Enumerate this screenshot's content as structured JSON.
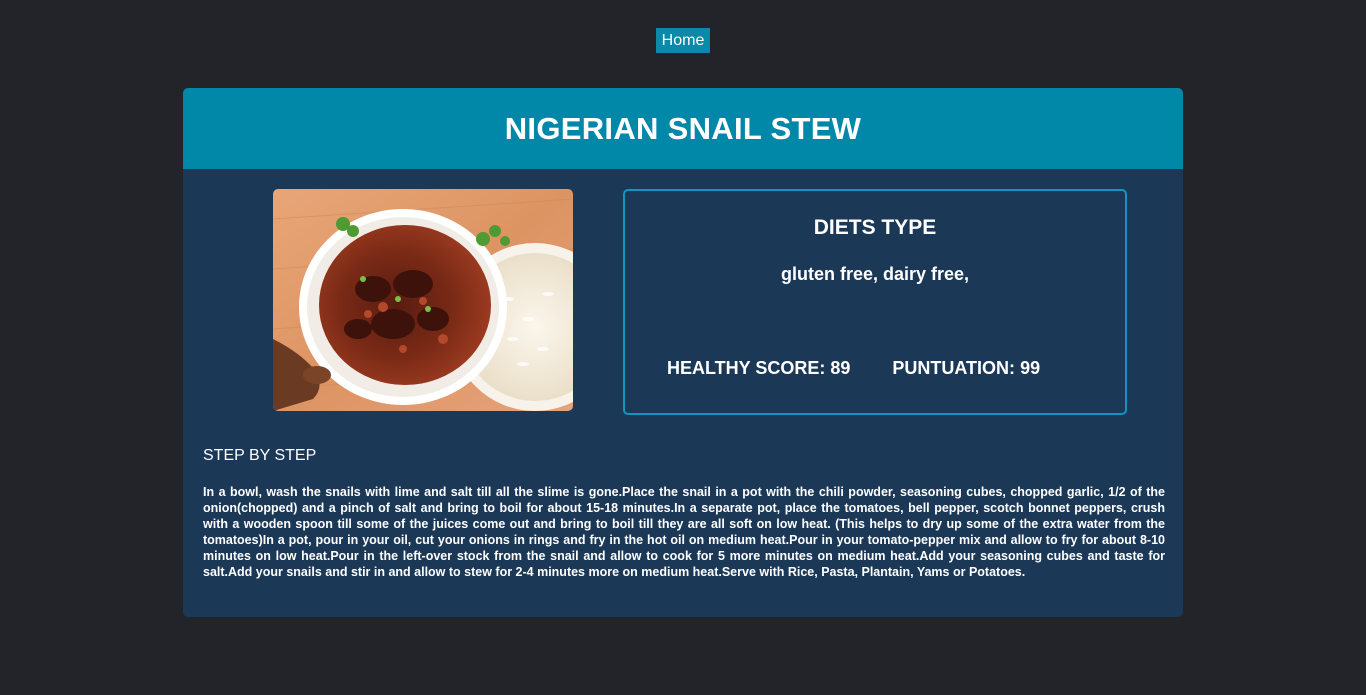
{
  "nav": {
    "home_label": "Home"
  },
  "recipe": {
    "title": "NIGERIAN SNAIL STEW",
    "image_alt": "Nigerian snail stew with rice",
    "diets_heading": "DIETS TYPE",
    "diets": "gluten free, dairy free,",
    "healthy_score_label": "HEALTHY SCORE:",
    "healthy_score": "89",
    "puntuation_label": "PUNTUATION:",
    "puntuation": "99",
    "steps_heading": "STEP BY STEP",
    "steps_text": "In a bowl, wash the snails with lime and salt till all the slime is gone.Place the snail in a pot with the chili powder, seasoning cubes, chopped garlic, 1/2 of the onion(chopped) and a pinch of salt and bring to boil for about 15-18 minutes.In a separate pot, place the tomatoes, bell pepper, scotch bonnet peppers, crush with a wooden spoon till some of the juices come out and bring to boil till they are all soft on low heat. (This helps to dry up some of the extra water from the tomatoes)In a pot, pour in your oil, cut your onions in rings and fry in the hot oil on medium heat.Pour in your tomato-pepper mix and allow to fry for about 8-10 minutes on low heat.Pour in the left-over stock from the snail and allow to cook for 5 more minutes on medium heat.Add your seasoning cubes and taste for salt.Add your snails and stir in and allow to stew for 2-4 minutes more on medium heat.Serve with Rice, Pasta, Plantain, Yams or Potatoes."
  },
  "colors": {
    "page_bg": "#232429",
    "card_bg": "#1b3857",
    "header_bg": "#0187a8",
    "accent_border": "#1197bf",
    "button_bg": "#0a8aa8"
  }
}
